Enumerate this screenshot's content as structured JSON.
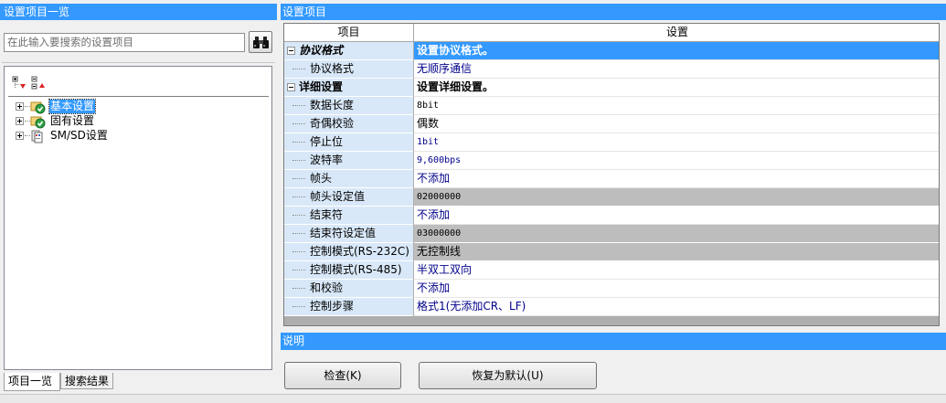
{
  "left_panel": {
    "title": "设置项目一览",
    "search_placeholder": "在此输入要搜索的设置项目",
    "tree": [
      {
        "label": "基本设置",
        "selected": true
      },
      {
        "label": "固有设置",
        "selected": false
      },
      {
        "label": "SM/SD设置",
        "selected": false
      }
    ],
    "tabs": [
      "项目一览",
      "搜索结果"
    ]
  },
  "right_panel": {
    "title": "设置项目",
    "columns": [
      "项目",
      "设置"
    ],
    "rows": [
      {
        "item": "协议格式",
        "value": "设置协议格式。",
        "kind": "group-selected"
      },
      {
        "item": "协议格式",
        "value": "无顺序通信",
        "kind": "child"
      },
      {
        "item": "详细设置",
        "value": "设置详细设置。",
        "kind": "group"
      },
      {
        "item": "数据长度",
        "value": "8bit",
        "kind": "child"
      },
      {
        "item": "奇偶校验",
        "value": "偶数",
        "kind": "child"
      },
      {
        "item": "停止位",
        "value": "1bit",
        "kind": "child"
      },
      {
        "item": "波特率",
        "value": "9,600bps",
        "kind": "child"
      },
      {
        "item": "帧头",
        "value": "不添加",
        "kind": "child"
      },
      {
        "item": "帧头设定值",
        "value": "02000000",
        "kind": "child-grey"
      },
      {
        "item": "结束符",
        "value": "不添加",
        "kind": "child"
      },
      {
        "item": "结束符设定值",
        "value": "03000000",
        "kind": "child-grey"
      },
      {
        "item": "控制模式(RS-232C)",
        "value": "无控制线",
        "kind": "child-grey"
      },
      {
        "item": "控制模式(RS-485)",
        "value": "半双工双向",
        "kind": "child"
      },
      {
        "item": "和校验",
        "value": "不添加",
        "kind": "child"
      },
      {
        "item": "控制步骤",
        "value": "格式1(无添加CR、LF)",
        "kind": "child"
      }
    ],
    "description_title": "说明",
    "buttons": {
      "check": "检查(K)",
      "restore": "恢复为默认(U)"
    }
  },
  "colors": {
    "accent": "#3399ff",
    "item_column_bg": "#d9e8f8",
    "disabled_value_bg": "#bdbdbd",
    "value_text": "#00008b"
  }
}
